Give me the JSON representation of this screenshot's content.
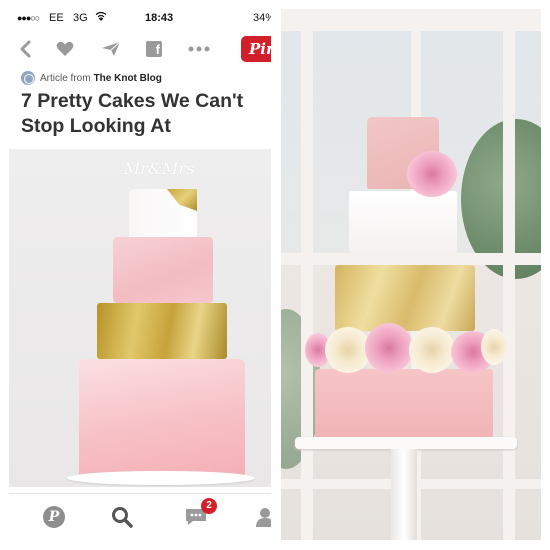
{
  "status_bar": {
    "signal": "●●●○○",
    "carrier": "EE",
    "network": "3G",
    "time": "18:43",
    "battery": "34%"
  },
  "toolbar": {
    "back_icon": "back-chevron-icon",
    "like_icon": "heart-icon",
    "send_icon": "send-icon",
    "facebook_icon": "facebook-icon",
    "more_icon": "more-icon",
    "pinterest_label": "Pinterest"
  },
  "article": {
    "source_prefix": "Article from",
    "source_name": "The Knot Blog",
    "title": "7 Pretty Cakes We Can't Stop Looking At"
  },
  "photo_left": {
    "topper_text": "Mr&Mrs"
  },
  "tab_bar": {
    "home_icon": "pinterest-home-icon",
    "search_icon": "search-icon",
    "messages_icon": "messages-icon",
    "messages_badge": "2",
    "profile_icon": "profile-icon"
  },
  "colors": {
    "pinterest_red": "#d2202a",
    "icon_gray": "#9a9a9a",
    "title_text": "#333333"
  }
}
